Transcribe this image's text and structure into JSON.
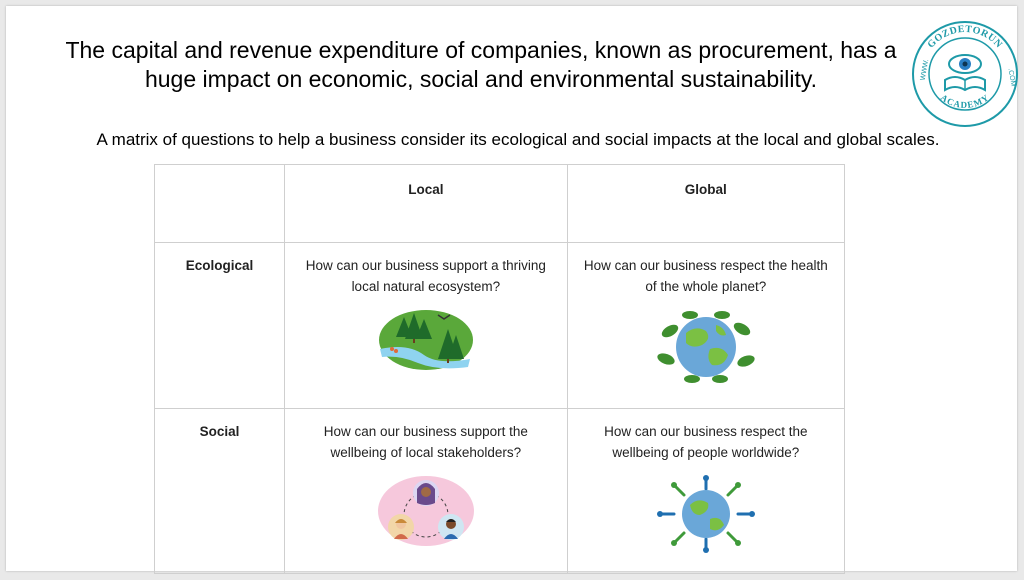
{
  "slide": {
    "title": "The capital and revenue expenditure of companies, known as procurement, has a huge impact on economic, social and environmental sustainability.",
    "subtitle": "A matrix of questions to help a business consider its ecological and social impacts at the local and global scales.",
    "logo": {
      "top_text": "GOZDETORUN",
      "left_text": "WWW.",
      "right_text": ".COM",
      "bottom_text": "ACADEMY",
      "icon": "eye-book-icon"
    }
  },
  "matrix": {
    "columns": [
      "",
      "Local",
      "Global"
    ],
    "rows": [
      {
        "label": "Ecological",
        "local": "How can our business support a thriving local natural ecosystem?",
        "global": "How can our business respect the health of the whole planet?",
        "local_icon": "forest-river-icon",
        "global_icon": "leafy-globe-icon"
      },
      {
        "label": "Social",
        "local": "How can our business support the wellbeing of local stakeholders?",
        "global": "How can our business respect the wellbeing of people worldwide?",
        "local_icon": "stakeholders-icon",
        "global_icon": "people-around-globe-icon"
      }
    ]
  },
  "colors": {
    "logo_teal": "#1e9aa8",
    "forest_green": "#5aa83a",
    "globe_blue": "#6aa7d8",
    "stakeholder_pink": "#f6c8dc"
  }
}
